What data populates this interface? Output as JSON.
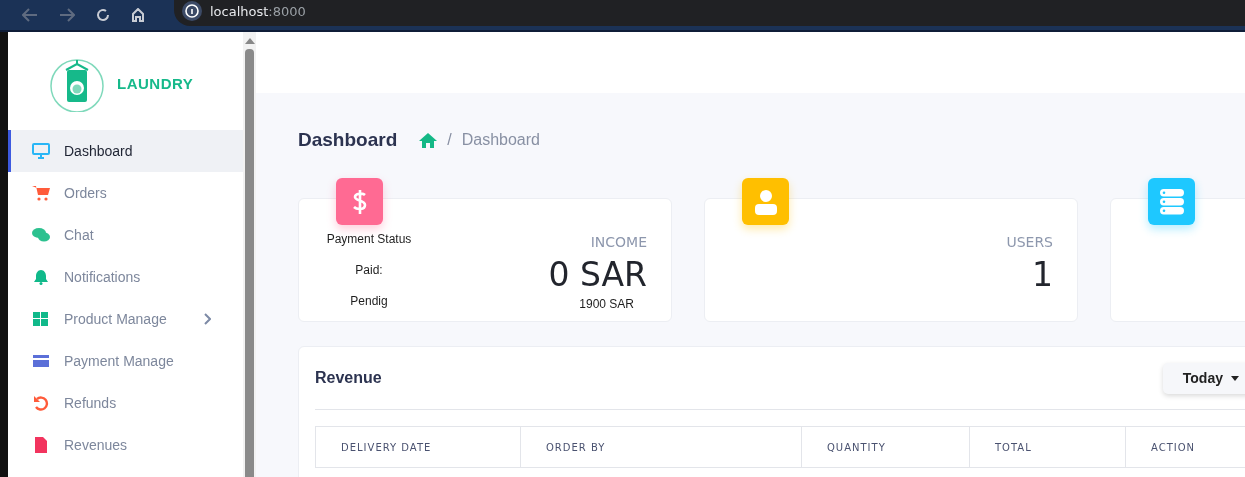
{
  "browser": {
    "host": "localhost",
    "port": ":8000"
  },
  "sidebar": {
    "brand": "LAUNDRY",
    "items": [
      {
        "label": "Dashboard",
        "kind": "monitor",
        "color": "#29b6f6",
        "selected": true,
        "expandable": false
      },
      {
        "label": "Orders",
        "kind": "cart",
        "color": "#ff5b3a",
        "selected": false,
        "expandable": false
      },
      {
        "label": "Chat",
        "kind": "chat",
        "color": "#2cc18f",
        "selected": false,
        "expandable": false
      },
      {
        "label": "Notifications",
        "kind": "bell",
        "color": "#10b98a",
        "selected": false,
        "expandable": false
      },
      {
        "label": "Product Manage",
        "kind": "grid",
        "color": "#10b98a",
        "selected": false,
        "expandable": true
      },
      {
        "label": "Payment Manage",
        "kind": "card",
        "color": "#5b6fd8",
        "selected": false,
        "expandable": false
      },
      {
        "label": "Refunds",
        "kind": "undo",
        "color": "#ff5b3a",
        "selected": false,
        "expandable": false
      },
      {
        "label": "Revenues",
        "kind": "file",
        "color": "#f2345e",
        "selected": false,
        "expandable": false
      }
    ]
  },
  "page": {
    "title": "Dashboard",
    "breadcrumb": [
      "/",
      "Dashboard"
    ]
  },
  "cards": [
    {
      "kind": "dollar",
      "color": "#ff6a93",
      "details": [
        "Payment Status",
        "Paid:",
        "Pendig"
      ],
      "label": "INCOME",
      "value": "0 SAR",
      "note": "1900 SAR"
    },
    {
      "kind": "user",
      "color": "#ffbf00",
      "label": "USERS",
      "value": "1"
    },
    {
      "kind": "server",
      "color": "#1ec8ff"
    }
  ],
  "revenue": {
    "title": "Revenue",
    "filter": "Today",
    "columns": [
      "DELIVERY DATE",
      "ORDER BY",
      "QUANTITY",
      "TOTAL",
      "ACTION"
    ]
  }
}
